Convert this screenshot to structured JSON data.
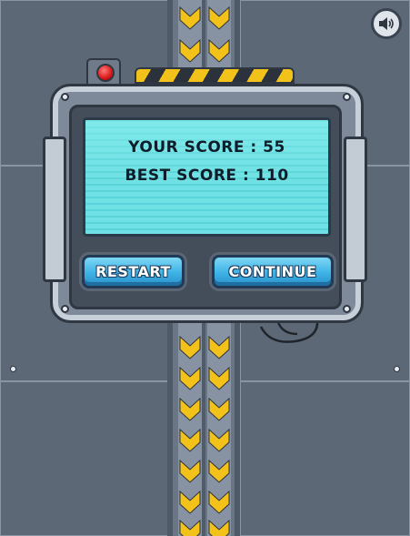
{
  "sound_button": {
    "icon": "speaker-icon"
  },
  "score_panel": {
    "your_score_label": "YOUR SCORE : 55",
    "best_score_label": "BEST SCORE : 110",
    "your_score": 55,
    "best_score": 110
  },
  "buttons": {
    "restart_label": "RESTART",
    "continue_label": "CONTINUE"
  },
  "colors": {
    "background": "#5b6675",
    "screen": "#6fe0e3",
    "button": "#3db2e6",
    "hazard_yellow": "#f2c21a",
    "light_red": "#d81818"
  }
}
